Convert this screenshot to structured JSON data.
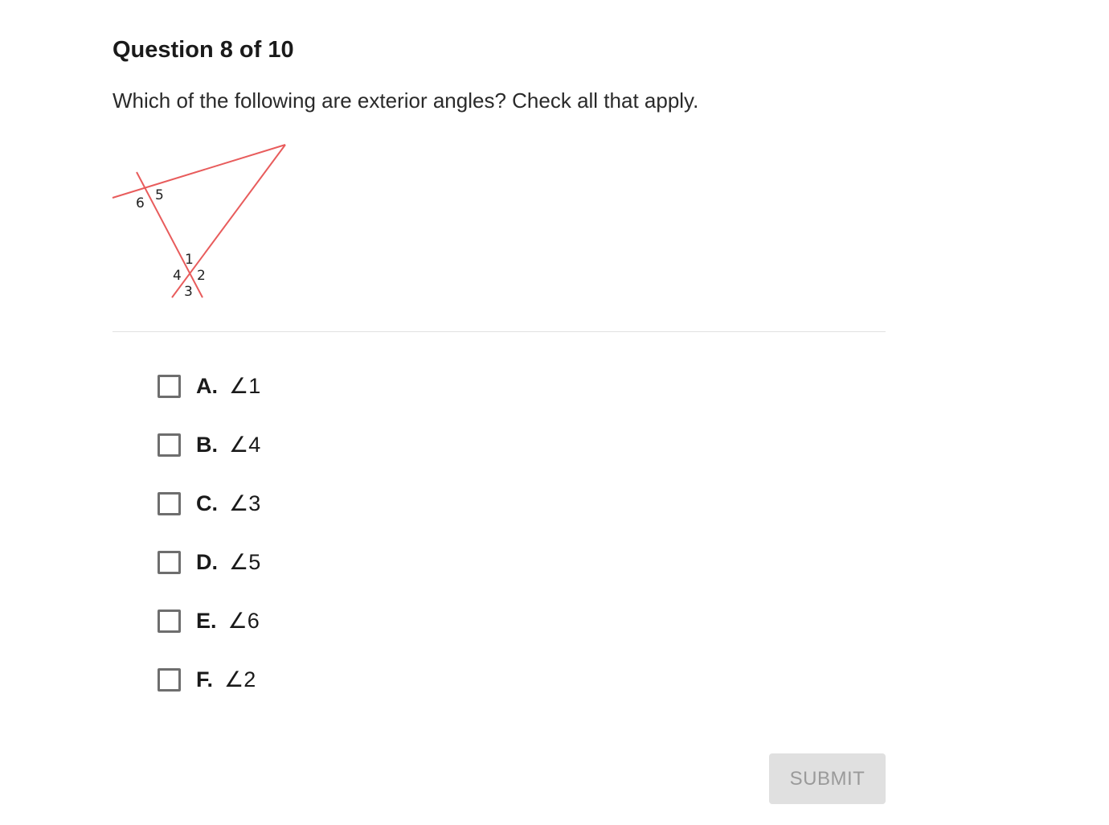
{
  "question": {
    "header": "Question 8 of 10",
    "prompt": "Which of the following are exterior angles? Check all that apply.",
    "figure": {
      "line_color": "#e85c5c",
      "labels": [
        "1",
        "2",
        "3",
        "4",
        "5",
        "6"
      ]
    }
  },
  "options": [
    {
      "letter": "A.",
      "text": "∠1",
      "checked": false
    },
    {
      "letter": "B.",
      "text": "∠4",
      "checked": false
    },
    {
      "letter": "C.",
      "text": "∠3",
      "checked": false
    },
    {
      "letter": "D.",
      "text": "∠5",
      "checked": false
    },
    {
      "letter": "E.",
      "text": "∠6",
      "checked": false
    },
    {
      "letter": "F.",
      "text": "∠2",
      "checked": false
    }
  ],
  "submit": {
    "label": "SUBMIT",
    "enabled": false
  }
}
